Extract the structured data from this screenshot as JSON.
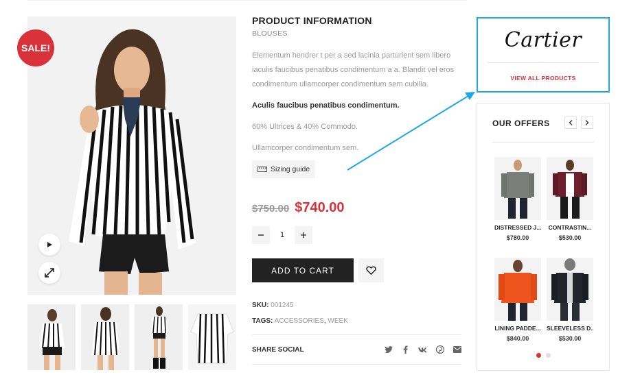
{
  "gallery": {
    "sale_label": "SALE!",
    "play_icon": "play-icon",
    "expand_icon": "expand-icon",
    "thumbnails": 4
  },
  "product": {
    "title": "PRODUCT INFORMATION",
    "category": "BLOUSES",
    "description": "Elementum hendrer t per a sed lacinia parturient sem libero iaculis faucibus penatibus condimentum a a. Blandit vel eros condimentum ullamcorper condimentum sem cubilia.",
    "bold_line": "Aculis faucibus penatibus condimentum.",
    "material": "60% Ultrices & 40% Commodo.",
    "extra_line": "Ullamcorper condimentum sem.",
    "sizing_label": "Sizing guide",
    "old_price": "$750.00",
    "new_price": "$740.00",
    "quantity": "1",
    "add_to_cart": "ADD TO CART",
    "sku_label": "SKU:",
    "sku_value": "001245",
    "tags_label": "TAGS:",
    "tag_1": "ACCESSORIES",
    "tag_sep": ",",
    "tag_2": "WEEK",
    "share_label": "SHARE SOCIAL"
  },
  "brand": {
    "logo_text": "Cartier",
    "link": "VIEW ALL PRODUCTS"
  },
  "offers": {
    "title": "OUR OFFERS",
    "items": [
      {
        "name": "DISTRESSED J...",
        "price": "$780.00"
      },
      {
        "name": "CONTRASTIN...",
        "price": "$530.00"
      },
      {
        "name": "LINING PADDE...",
        "price": "$840.00"
      },
      {
        "name": "SLEEVELESS D...",
        "price": "$530.00"
      }
    ],
    "active_page": 1,
    "pages": 2
  },
  "colors": {
    "accent": "#d9323a",
    "annotation": "#1da9e6",
    "button": "#222222"
  }
}
